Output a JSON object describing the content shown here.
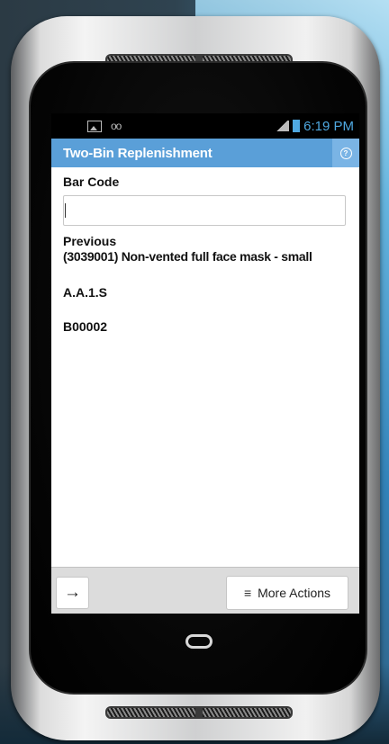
{
  "status_bar": {
    "time": "6:19 PM",
    "icons": [
      "image-icon",
      "voicemail-icon",
      "signal-icon",
      "battery-icon"
    ]
  },
  "app_bar": {
    "title": "Two-Bin Replenishment",
    "help_icon": "help-icon"
  },
  "form": {
    "barcode_label": "Bar Code",
    "barcode_value": "",
    "previous_label": "Previous",
    "previous_item": "(3039001) Non-vented full face mask - small",
    "location": "A.A.1.S",
    "bin": "B00002"
  },
  "bottom_bar": {
    "go_icon": "→",
    "more_actions_icon": "≡",
    "more_actions_label": "More Actions"
  },
  "colors": {
    "app_bar": "#5a9fd8",
    "status_time": "#4fa8e0"
  }
}
